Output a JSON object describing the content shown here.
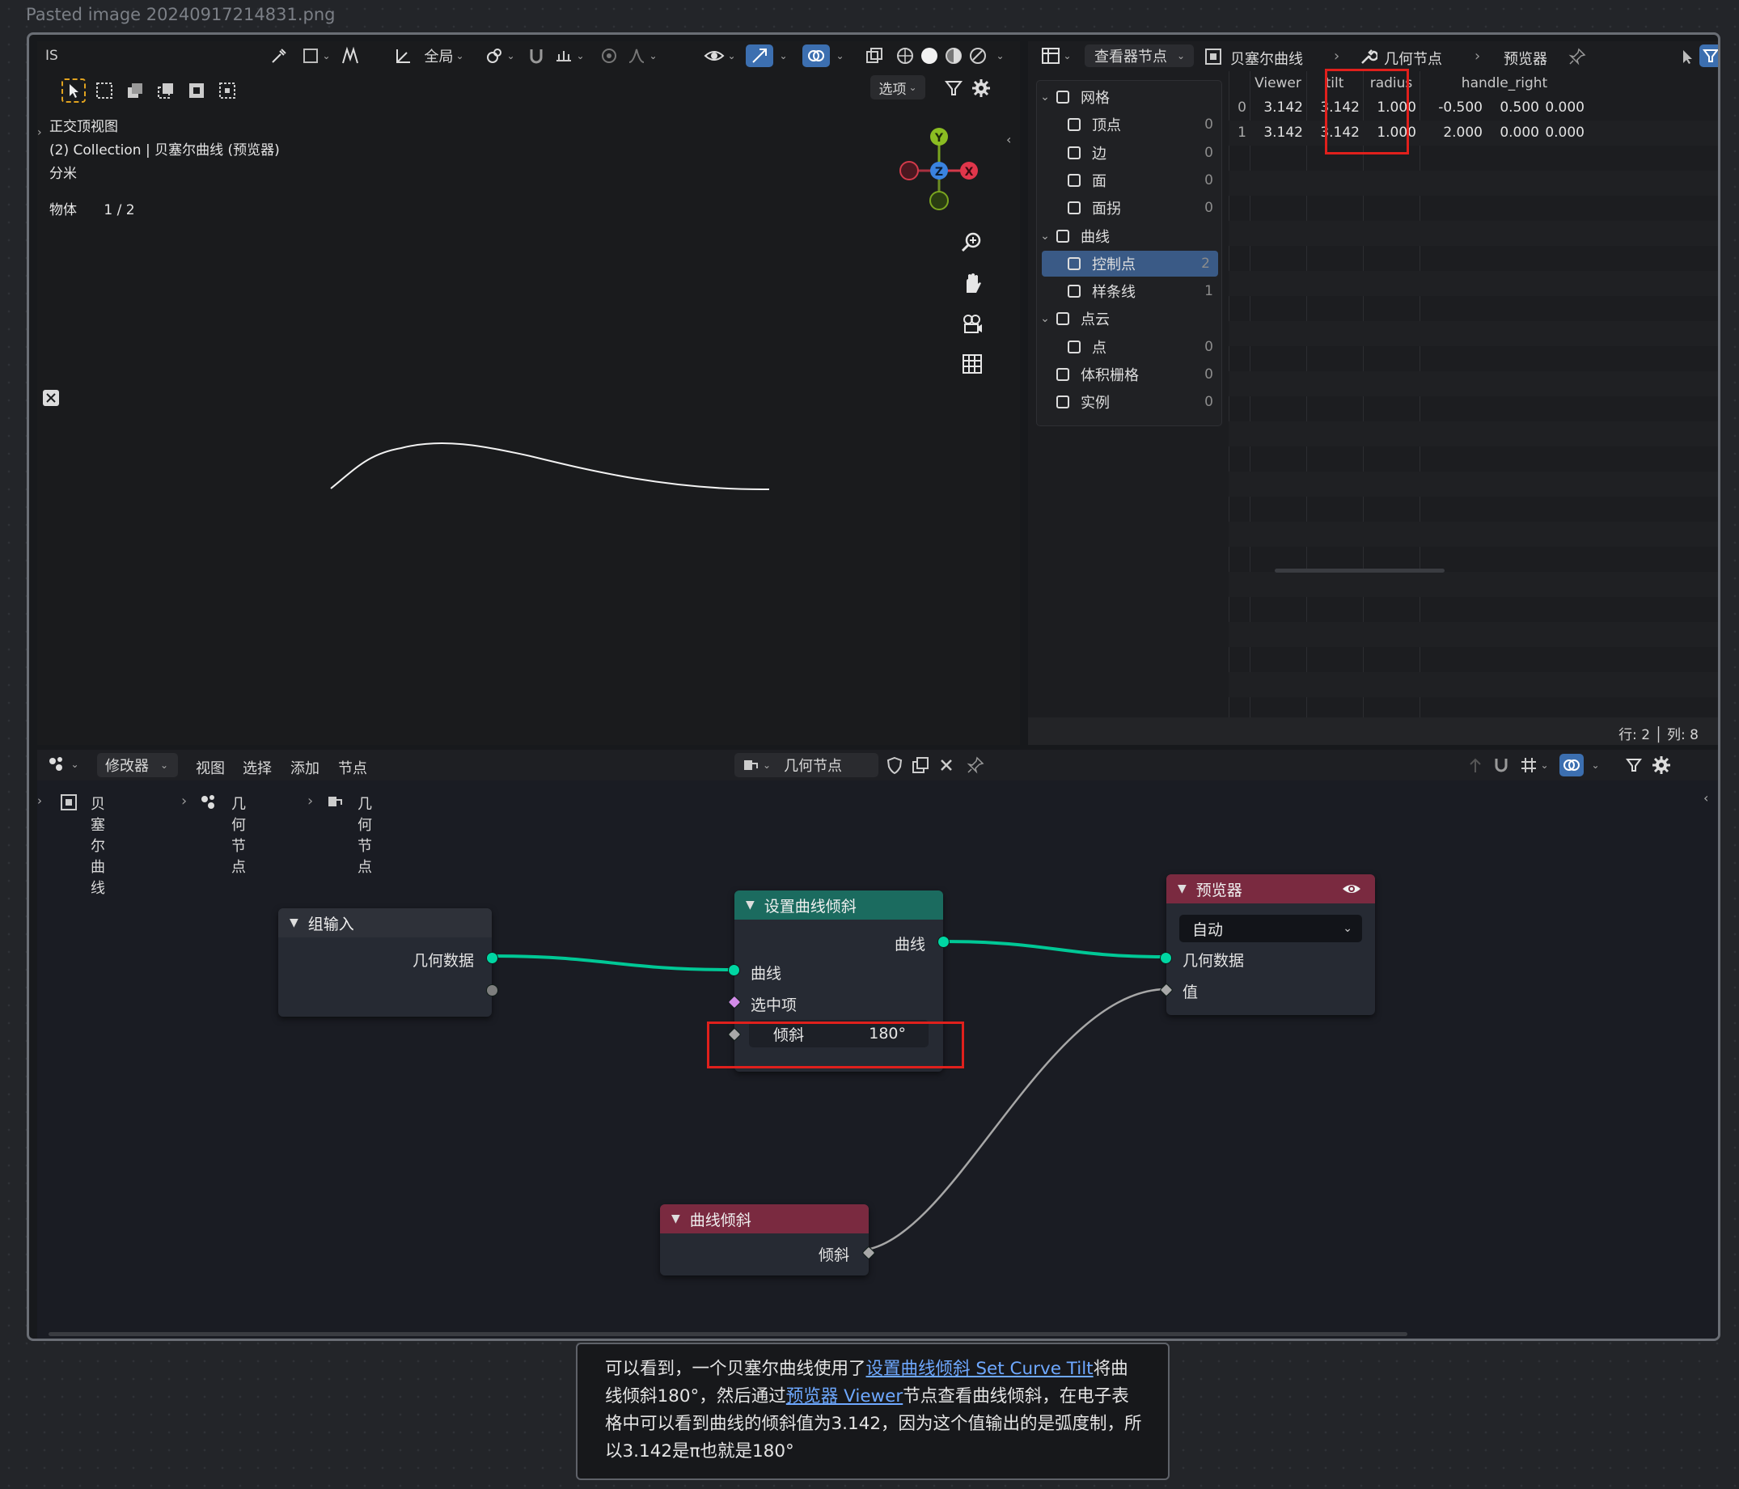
{
  "filename": "Pasted image 20240917214831.png",
  "viewport": {
    "left_tag": "IS",
    "global_label": "全局",
    "options_label": "选项",
    "view_name": "正交顶视图",
    "collection_line": "(2) Collection | 贝塞尔曲线 (预览器)",
    "unit": "分米",
    "object_label": "物体",
    "object_count": "1 / 2",
    "axis_y": "Y",
    "axis_x": "X",
    "axis_z": "Z"
  },
  "sheet": {
    "viewer_dropdown": "查看器节点",
    "breadcrumbs": [
      "贝塞尔曲线",
      "几何节点",
      "预览器"
    ],
    "tree": [
      {
        "label": "网格",
        "count": "",
        "level": 0,
        "icon": "mesh-icon"
      },
      {
        "label": "顶点",
        "count": "0",
        "level": 1,
        "icon": "vertex-icon"
      },
      {
        "label": "边",
        "count": "0",
        "level": 1,
        "icon": "edge-icon"
      },
      {
        "label": "面",
        "count": "0",
        "level": 1,
        "icon": "face-icon"
      },
      {
        "label": "面拐",
        "count": "0",
        "level": 1,
        "icon": "face-corner-icon"
      },
      {
        "label": "曲线",
        "count": "",
        "level": 0,
        "icon": "curve-icon"
      },
      {
        "label": "控制点",
        "count": "2",
        "level": 1,
        "icon": "control-point-icon",
        "selected": true
      },
      {
        "label": "样条线",
        "count": "1",
        "level": 1,
        "icon": "spline-icon"
      },
      {
        "label": "点云",
        "count": "",
        "level": 0,
        "icon": "point-cloud-icon"
      },
      {
        "label": "点",
        "count": "0",
        "level": 1,
        "icon": "point-icon"
      },
      {
        "label": "体积栅格",
        "count": "0",
        "level": 0,
        "icon": "volume-grid-icon"
      },
      {
        "label": "实例",
        "count": "0",
        "level": 0,
        "icon": "instance-icon"
      }
    ],
    "columns": [
      "Viewer",
      "tilt",
      "radius",
      "handle_right"
    ],
    "rows": [
      {
        "index": "0",
        "viewer": "3.142",
        "tilt": "3.142",
        "radius": "1.000",
        "h1": "-0.500",
        "h2": "0.500",
        "h3": "0.000"
      },
      {
        "index": "1",
        "viewer": "3.142",
        "tilt": "3.142",
        "radius": "1.000",
        "h1": "2.000",
        "h2": "0.000",
        "h3": "0.000"
      }
    ],
    "status": "行: 2 │ 列: 8"
  },
  "node_editor": {
    "menu": {
      "modifier": "修改器",
      "view": "视图",
      "select": "选择",
      "add": "添加",
      "node": "节点"
    },
    "tree_name": "几何节点",
    "breadcrumbs": [
      "贝塞尔曲线",
      "几何节点",
      "几何节点"
    ],
    "group_input": {
      "title": "组输入",
      "geometry": "几何数据"
    },
    "set_curve_tilt": {
      "title": "设置曲线倾斜",
      "out_curve": "曲线",
      "in_curve": "曲线",
      "selection": "选中项",
      "tilt_label": "倾斜",
      "tilt_value": "180°"
    },
    "viewer": {
      "title": "预览器",
      "domain": "自动",
      "geometry": "几何数据",
      "value": "值"
    },
    "curve_tilt": {
      "title": "曲线倾斜",
      "out_tilt": "倾斜"
    }
  },
  "caption": {
    "p1": "可以看到，一个贝塞尔曲线使用了",
    "link1": "设置曲线倾斜 Set Curve Tilt",
    "p2": "将曲线倾斜180°，然后通过",
    "link2": "预览器 Viewer",
    "p3": "节点查看曲线倾斜，在电子表格中可以看到曲线的倾斜值为3.142，因为这个值输出的是弧度制，所以3.142是π也就是180°"
  },
  "colors": {
    "geometry_socket": "#00d6a3",
    "set_tilt_header": "#1b6b5f",
    "viewer_header": "#7a2a40",
    "highlight": "#e0201c"
  }
}
